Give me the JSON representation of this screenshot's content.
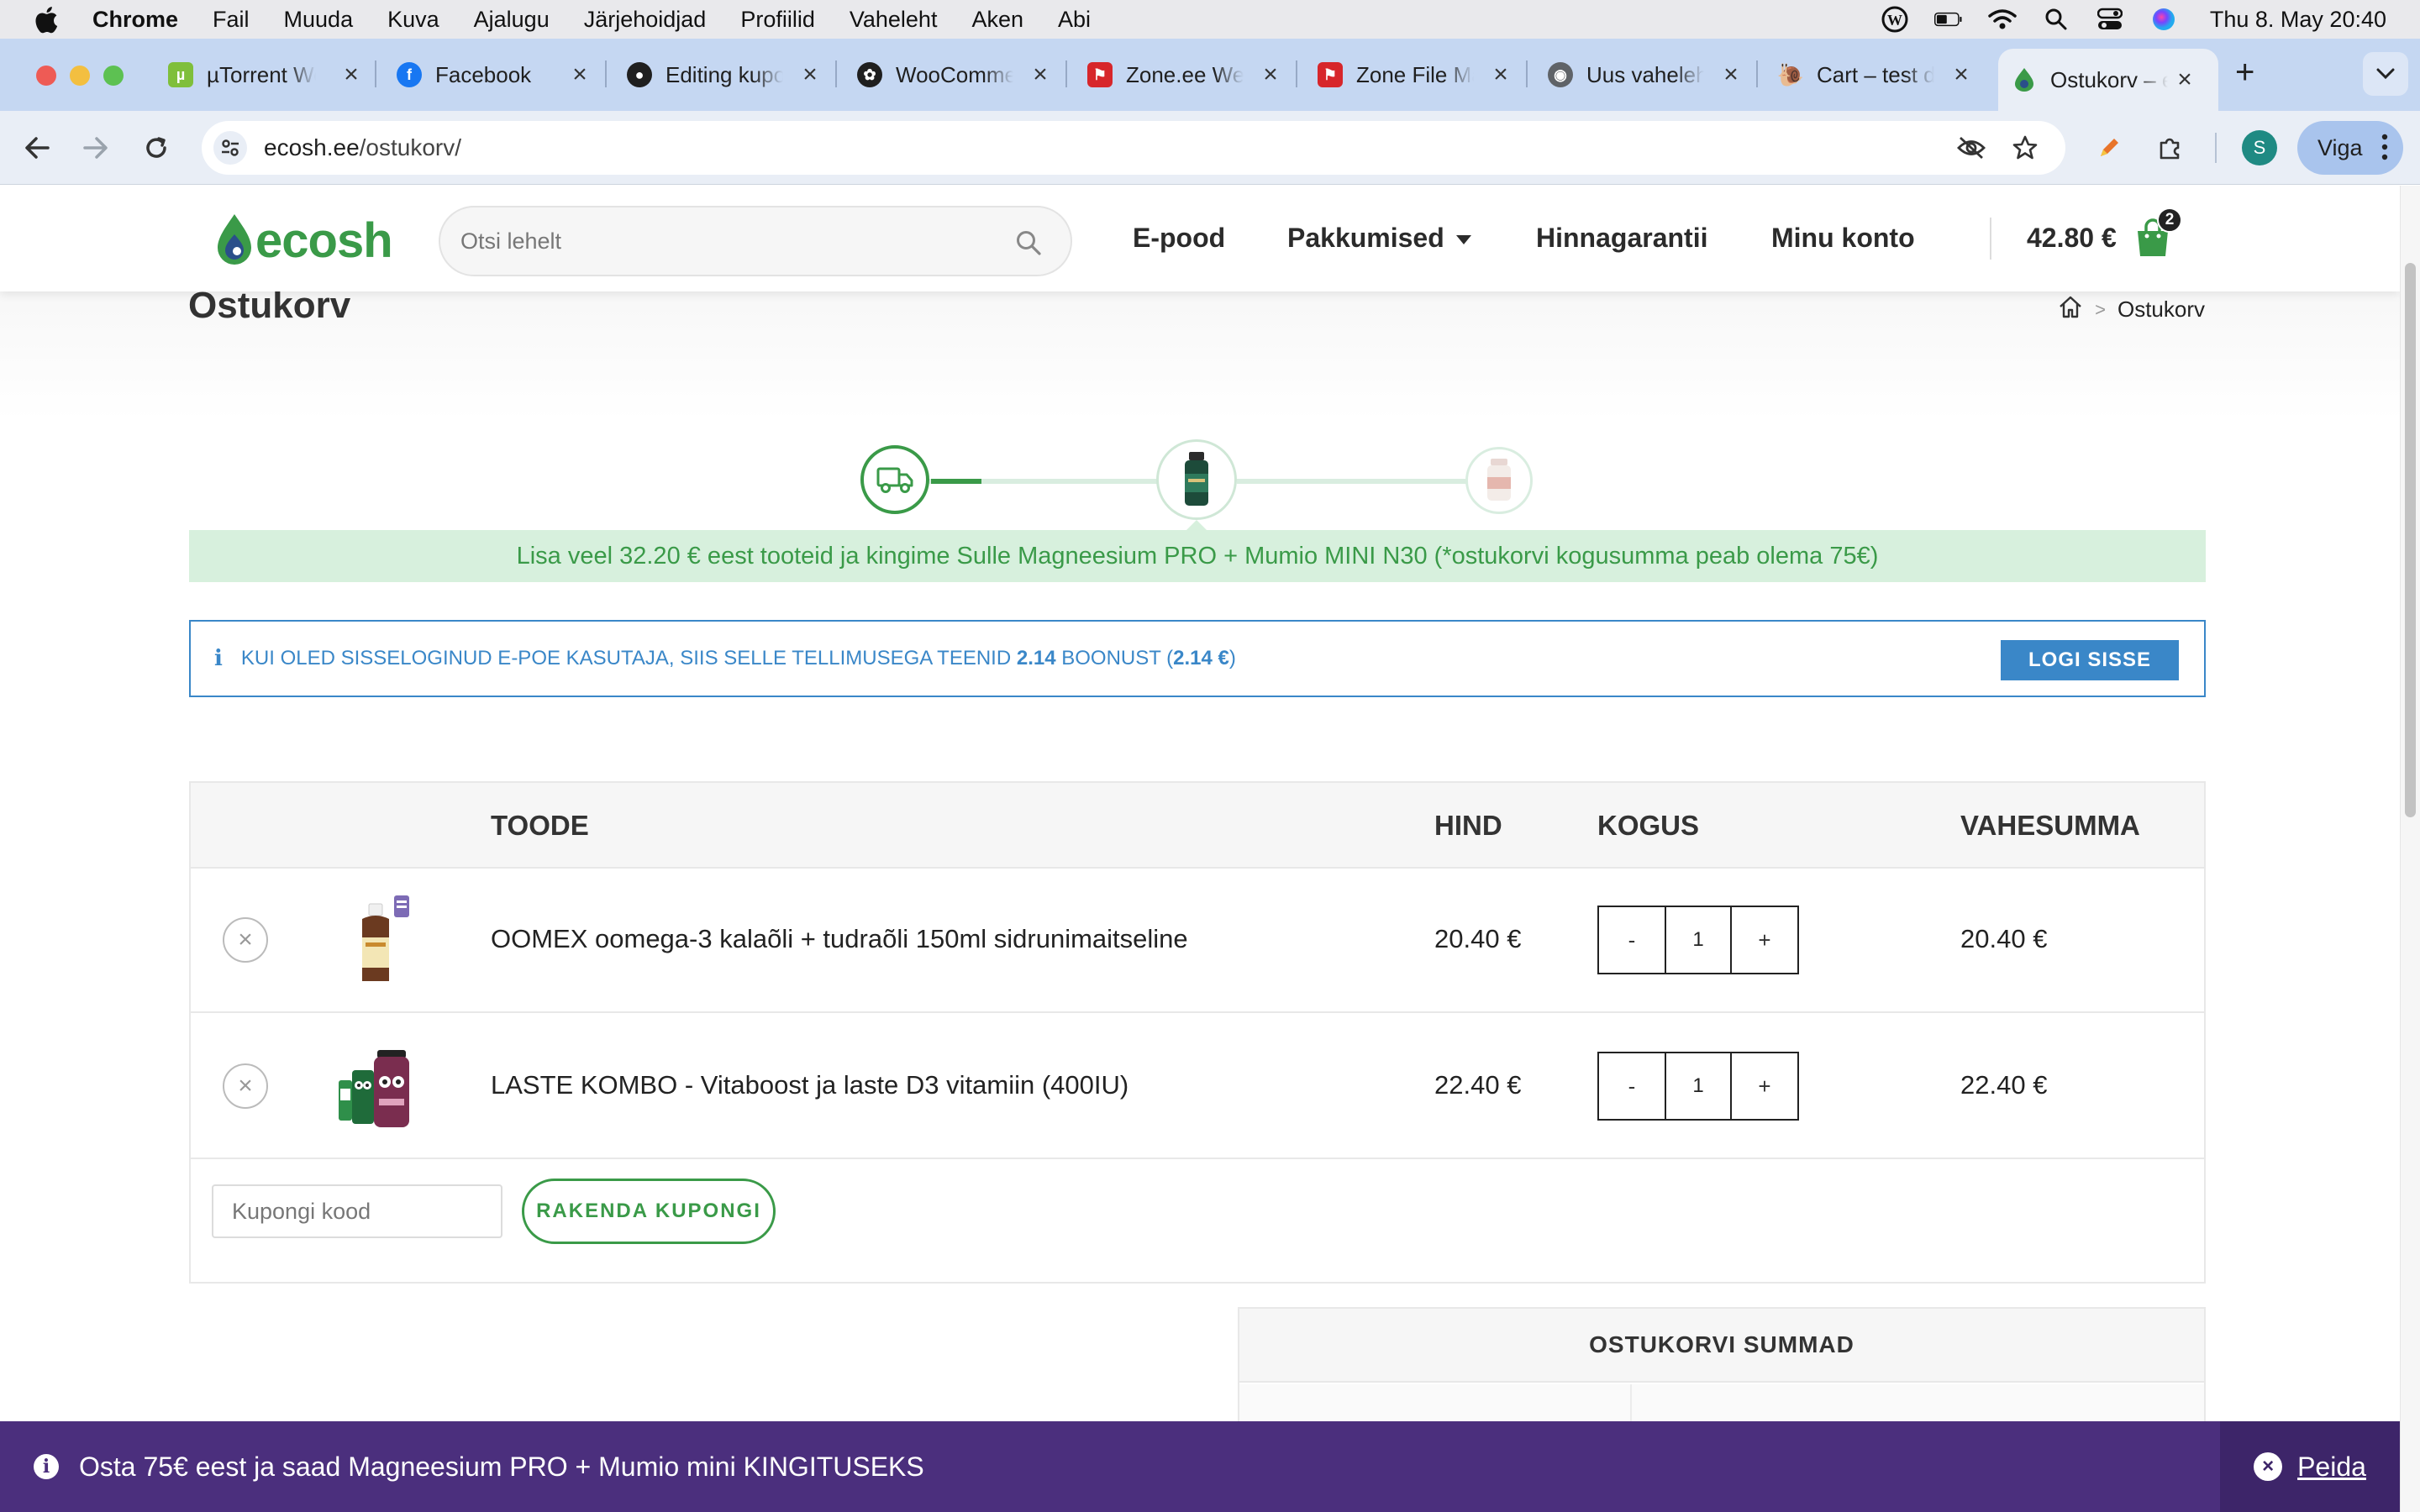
{
  "menubar": {
    "app_name": "Chrome",
    "items": [
      "Fail",
      "Muuda",
      "Kuva",
      "Ajalugu",
      "Järjehoidjad",
      "Profiilid",
      "Vaheleht",
      "Aken",
      "Abi"
    ],
    "clock": "Thu 8. May  20:40"
  },
  "tabs": [
    {
      "title": "µTorrent Web",
      "icon": "utorrent-icon",
      "color": "#7fbf3b"
    },
    {
      "title": "Facebook",
      "icon": "facebook-icon",
      "color": "#1877f2"
    },
    {
      "title": "Editing kupo",
      "icon": "github-icon",
      "color": "#1f1f1f"
    },
    {
      "title": "WooCommerce",
      "icon": "openai-icon",
      "color": "#1f1f1f"
    },
    {
      "title": "Zone.ee Web",
      "icon": "zone-icon",
      "color": "#d7262b"
    },
    {
      "title": "Zone File Ma",
      "icon": "zone-icon",
      "color": "#d7262b"
    },
    {
      "title": "Uus vaheleht",
      "icon": "chrome-icon",
      "color": "#5f6368"
    },
    {
      "title": "Cart – test d",
      "icon": "snail-icon",
      "color": "#1f1f1f"
    },
    {
      "title": "Ostukorv – e",
      "icon": "ecosh-icon",
      "color": "#3a9a48"
    }
  ],
  "toolbar": {
    "url_host": "ecosh.ee",
    "url_path": "/ostukorv/",
    "profile_initial": "S",
    "error_label": "Viga"
  },
  "header": {
    "logo_text": "ecosh",
    "search_placeholder": "Otsi lehelt",
    "nav": {
      "shop": "E-pood",
      "offers": "Pakkumised",
      "price_guarantee": "Hinnagarantii",
      "account": "Minu konto"
    },
    "cart_total": "42.80 €",
    "cart_count": "2"
  },
  "page": {
    "title": "Ostukorv",
    "breadcrumb_current": "Ostukorv"
  },
  "promo_text": "Lisa veel 32.20 € eest tooteid ja kingime Sulle Magneesium PRO + Mumio MINI N30 (*ostukorvi kogusumma peab olema 75€)",
  "bonus": {
    "text_before": "KUI OLED SISSELOGINUD E-POE KASUTAJA, SIIS SELLE TELLIMUSEGA TEENID ",
    "points": "2.14",
    "text_middle": " BOONUST (",
    "value": "2.14 €",
    "text_after": ")",
    "login_label": "LOGI SISSE"
  },
  "cart": {
    "headers": {
      "product": "TOODE",
      "price": "HIND",
      "quantity": "KOGUS",
      "subtotal": "VAHESUMMA"
    },
    "items": [
      {
        "name": "OOMEX oomega-3 kalaõli + tudraõli 150ml sidrunimaitseline",
        "price": "20.40 €",
        "qty": "1",
        "subtotal": "20.40 €"
      },
      {
        "name": "LASTE KOMBO - Vitaboost ja laste D3 vitamiin (400IU)",
        "price": "22.40 €",
        "qty": "1",
        "subtotal": "22.40 €"
      }
    ],
    "minus": "-",
    "plus": "+",
    "coupon_placeholder": "Kupongi kood",
    "coupon_button": "RAKENDA KUPONGI"
  },
  "totals": {
    "title": "OSTUKORVI SUMMAD"
  },
  "banner": {
    "text": "Osta 75€ eest ja saad Magneesium PRO + Mumio mini KINGITUSEKS",
    "hide_label": "Peida"
  },
  "colors": {
    "brand_green": "#3a9a48",
    "info_blue": "#3a87c8",
    "banner_purple": "#4b2f7d",
    "promo_bg": "#d7f0dd"
  }
}
